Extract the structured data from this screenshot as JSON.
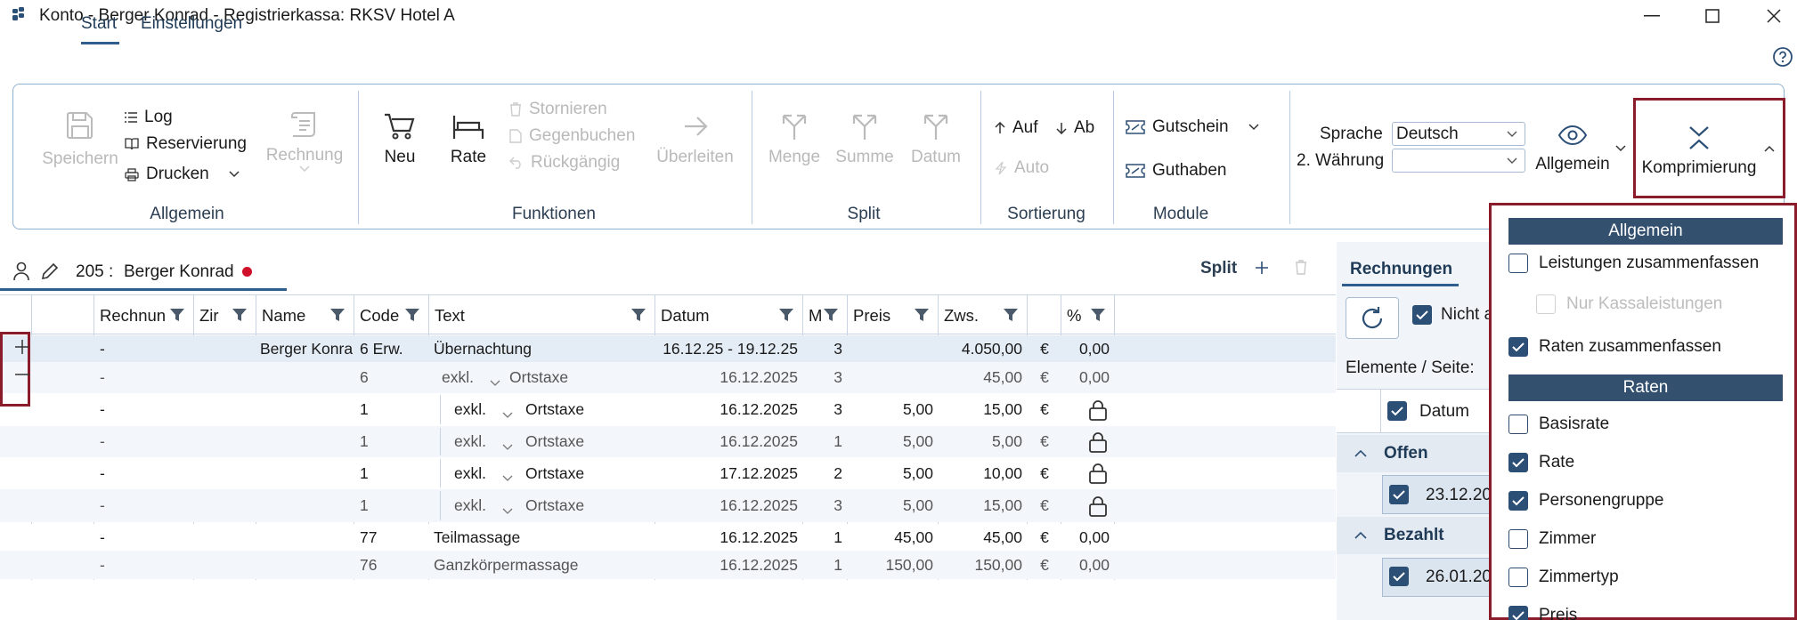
{
  "window": {
    "title": "Konto - Berger Konrad - Registrierkassa: RKSV Hotel A"
  },
  "menu_tabs": [
    "Start",
    "Einstellungen"
  ],
  "ribbon": {
    "allgemein": {
      "save": "Speichern",
      "log": "Log",
      "reservierung": "Reservierung",
      "drucken": "Drucken",
      "rechnung": "Rechnung",
      "group": "Allgemein"
    },
    "funktionen": {
      "neu": "Neu",
      "rate": "Rate",
      "stornieren": "Stornieren",
      "gegenbuchen": "Gegenbuchen",
      "rueckgaengig": "Rückgängig",
      "ueberleiten": "Überleiten",
      "group": "Funktionen"
    },
    "split": {
      "menge": "Menge",
      "summe": "Summe",
      "datum": "Datum",
      "group": "Split"
    },
    "sortierung": {
      "auf": "Auf",
      "ab": "Ab",
      "auto": "Auto",
      "group": "Sortierung"
    },
    "module": {
      "gutschein": "Gutschein",
      "guthaben": "Guthaben",
      "group": "Module"
    },
    "sprache": {
      "label": "Sprache",
      "value": "Deutsch",
      "waehrung_label": "2. Währung",
      "waehrung_value": ""
    },
    "allgemein_view": "Allgemein",
    "komprimierung": "Komprimierung"
  },
  "konto": {
    "room": "205 :",
    "name": "Berger Konrad",
    "split": "Split"
  },
  "table": {
    "headers": [
      "Rechnun",
      "Zir",
      "Name",
      "Code",
      "Text",
      "Datum",
      "M",
      "Preis",
      "Zws.",
      "",
      "%"
    ],
    "rows": [
      {
        "r": "-",
        "name": "Berger Konra",
        "code": "6 Erw.",
        "exkl": "",
        "text": "Übernachtung",
        "datum": "16.12.25 - 19.12.25",
        "m": "3",
        "preis": "",
        "zws": "4.050,00",
        "cur": "€",
        "pct": "0,00"
      },
      {
        "r": "-",
        "name": "",
        "code": "6",
        "exkl": "exkl.",
        "text": "Ortstaxe",
        "datum": "16.12.2025",
        "m": "3",
        "preis": "",
        "zws": "45,00",
        "cur": "€",
        "pct": "0,00"
      },
      {
        "r": "-",
        "name": "",
        "code": "1",
        "exkl": "exkl.",
        "text": "Ortstaxe",
        "datum": "16.12.2025",
        "m": "3",
        "preis": "5,00",
        "zws": "15,00",
        "cur": "€",
        "pct": ""
      },
      {
        "r": "-",
        "name": "",
        "code": "1",
        "exkl": "exkl.",
        "text": "Ortstaxe",
        "datum": "16.12.2025",
        "m": "1",
        "preis": "5,00",
        "zws": "5,00",
        "cur": "€",
        "pct": ""
      },
      {
        "r": "-",
        "name": "",
        "code": "1",
        "exkl": "exkl.",
        "text": "Ortstaxe",
        "datum": "17.12.2025",
        "m": "2",
        "preis": "5,00",
        "zws": "10,00",
        "cur": "€",
        "pct": ""
      },
      {
        "r": "-",
        "name": "",
        "code": "1",
        "exkl": "exkl.",
        "text": "Ortstaxe",
        "datum": "16.12.2025",
        "m": "3",
        "preis": "5,00",
        "zws": "15,00",
        "cur": "€",
        "pct": ""
      },
      {
        "r": "-",
        "name": "",
        "code": "77",
        "exkl": "",
        "text": "Teilmassage",
        "datum": "16.12.2025",
        "m": "1",
        "preis": "45,00",
        "zws": "45,00",
        "cur": "€",
        "pct": "0,00"
      },
      {
        "r": "-",
        "name": "",
        "code": "76",
        "exkl": "",
        "text": "Ganzkörpermassage",
        "datum": "16.12.2025",
        "m": "1",
        "preis": "150,00",
        "zws": "150,00",
        "cur": "€",
        "pct": "0,00"
      }
    ]
  },
  "right_panel": {
    "tab": "Rechnungen",
    "nicht": "Nicht a",
    "elemente": "Elemente / Seite:",
    "datum_header": "Datum",
    "offen": "Offen",
    "offen_date": "23.12.20",
    "bezahlt": "Bezahlt",
    "bezahlt_date": "26.01.20"
  },
  "popup": {
    "allgemein_head": "Allgemein",
    "leistungen": "Leistungen zusammenfassen",
    "nur_kassa": "Nur Kassaleistungen",
    "raten_zus": "Raten zusammenfassen",
    "raten_head": "Raten",
    "items": [
      {
        "label": "Basisrate",
        "checked": false
      },
      {
        "label": "Rate",
        "checked": true
      },
      {
        "label": "Personengruppe",
        "checked": true
      },
      {
        "label": "Zimmer",
        "checked": false
      },
      {
        "label": "Zimmertyp",
        "checked": false
      },
      {
        "label": "Preis",
        "checked": true
      }
    ]
  },
  "colors": {
    "accent": "#2c4f76",
    "highlight_border": "#8a1c2b",
    "ribbon_border": "#8fb1d4",
    "status_dot": "#d0102a"
  }
}
